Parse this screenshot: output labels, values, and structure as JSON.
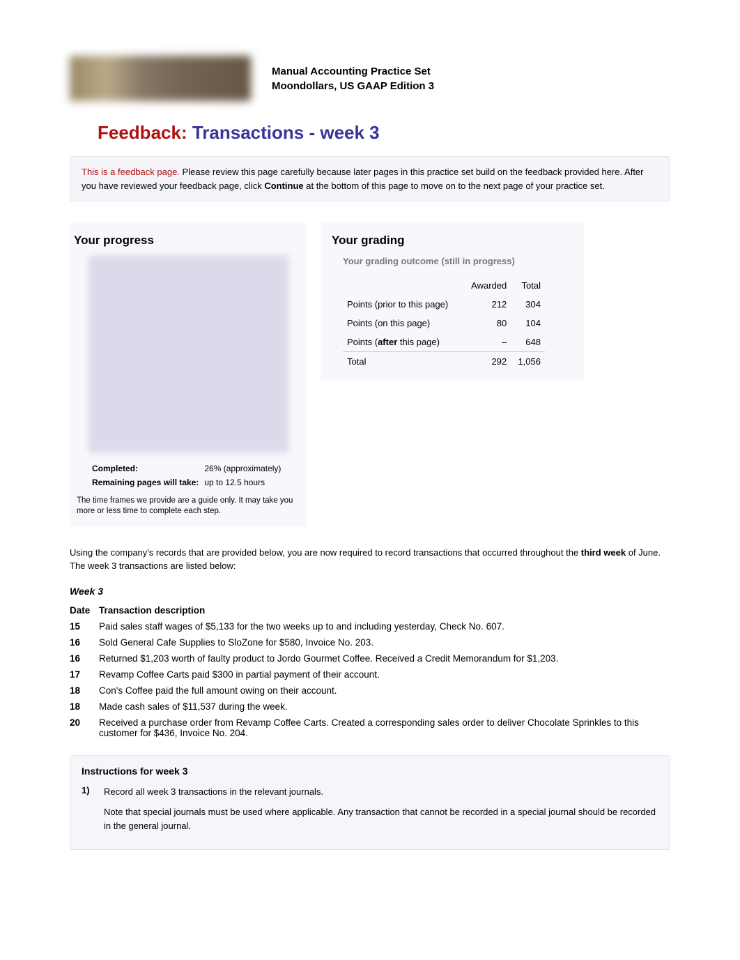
{
  "header": {
    "title_line1": "Manual Accounting Practice Set",
    "title_line2": "Moondollars, US GAAP Edition 3"
  },
  "page_heading": {
    "feedback_label": "Feedback:",
    "title": "Transactions - week 3"
  },
  "feedback_notice": {
    "tag": "This is a feedback page.",
    "body": "Please review this page carefully because later pages in this practice set build on the feedback provided here. After you have reviewed your feedback page, click ",
    "continue_word": "Continue",
    "body2": " at the bottom of this page to move on to the next page of your practice set."
  },
  "progress": {
    "heading": "Your progress",
    "completed_label": "Completed:",
    "completed_value": "26% (approximately)",
    "remaining_label": "Remaining pages will take:",
    "remaining_value": "up to 12.5 hours",
    "note": "The time frames we provide are a guide only. It may take you more or less time to complete each step."
  },
  "grading": {
    "heading": "Your grading",
    "subheading": "Your grading outcome (still in progress)",
    "col_awarded": "Awarded",
    "col_total": "Total",
    "rows": [
      {
        "label": "Points (prior to this page)",
        "awarded": "212",
        "total": "304"
      },
      {
        "label_pre": "Points (",
        "label_bold": "after",
        "label_post": " this page)",
        "label": "Points (on this page)",
        "awarded": "80",
        "total": "104"
      },
      {
        "label": "Points (after this page)",
        "awarded": "–",
        "total": "648",
        "bold_word": "after"
      }
    ],
    "total_row": {
      "label": "Total",
      "awarded": "292",
      "total": "1,056"
    }
  },
  "intro_text": {
    "part1": "Using the company's records that are provided below, you are now required to record transactions that occurred throughout the ",
    "bold": "third week",
    "part2": " of June. The week 3 transactions are listed below:"
  },
  "week_label": "Week 3",
  "txn_header": {
    "date": "Date",
    "desc": "Transaction description"
  },
  "transactions": [
    {
      "date": "15",
      "desc": "Paid sales staff wages of $5,133 for the two weeks up to and including yesterday, Check No. 607."
    },
    {
      "date": "16",
      "desc": "Sold General Cafe Supplies to SloZone for $580, Invoice No. 203."
    },
    {
      "date": "16",
      "desc": "Returned $1,203 worth of faulty product to Jordo Gourmet Coffee. Received a Credit Memorandum for $1,203."
    },
    {
      "date": "17",
      "desc": "Revamp Coffee Carts paid $300 in partial payment of their account."
    },
    {
      "date": "18",
      "desc": "Con's Coffee paid the full amount owing on their account."
    },
    {
      "date": "18",
      "desc": "Made cash sales of $11,537 during the week."
    },
    {
      "date": "20",
      "desc": "Received a purchase order from Revamp Coffee Carts. Created a corresponding sales order to deliver Chocolate Sprinkles to this customer for $436, Invoice No. 204."
    }
  ],
  "instructions": {
    "heading": "Instructions for week 3",
    "items": [
      {
        "num": "1)",
        "line1": "Record all week 3 transactions in the relevant journals.",
        "line2": "Note that special journals must be used where applicable. Any transaction that cannot be recorded in a special journal should be recorded in the general journal."
      }
    ]
  }
}
